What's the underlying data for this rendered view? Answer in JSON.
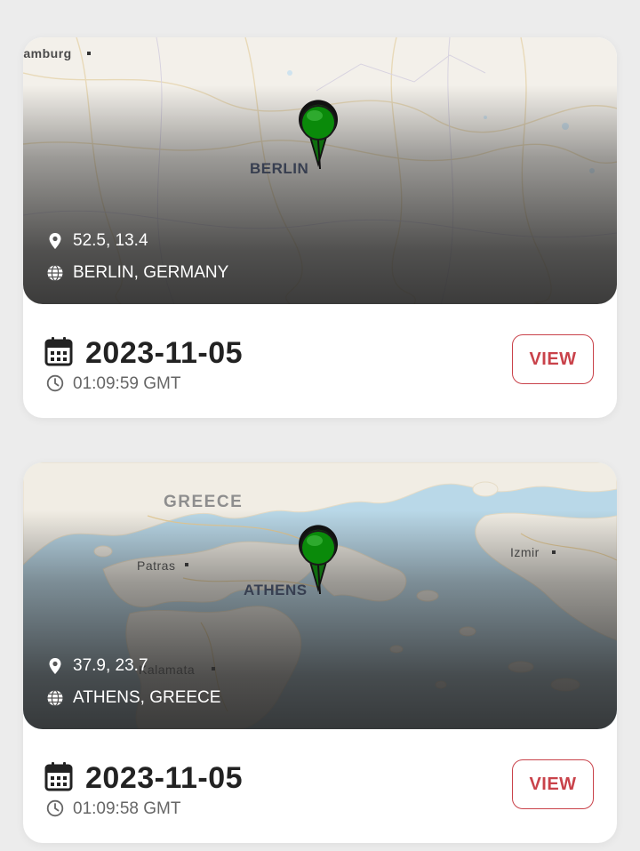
{
  "cards": [
    {
      "map": {
        "city_label": "BERLIN",
        "nearby_label": "lamburg",
        "theme": "land",
        "pin_color": "#0a8a0a"
      },
      "coords": "52.5, 13.4",
      "location": "BERLIN, GERMANY",
      "date": "2023-11-05",
      "time": "01:09:59 GMT",
      "view_label": "VIEW"
    },
    {
      "map": {
        "city_label": "ATHENS",
        "country_label": "GREECE",
        "labels": [
          "Patras",
          "Izmir",
          "Kalamata"
        ],
        "theme": "sea",
        "pin_color": "#0a8a0a"
      },
      "coords": "37.9, 23.7",
      "location": "ATHENS, GREECE",
      "date": "2023-11-05",
      "time": "01:09:58 GMT",
      "view_label": "VIEW"
    }
  ],
  "colors": {
    "accent": "#c9424a",
    "background": "#ececec",
    "card": "#ffffff"
  },
  "icons": {
    "coords": "map-pin-icon",
    "location": "globe-icon",
    "date": "calendar-icon",
    "time": "clock-icon"
  }
}
